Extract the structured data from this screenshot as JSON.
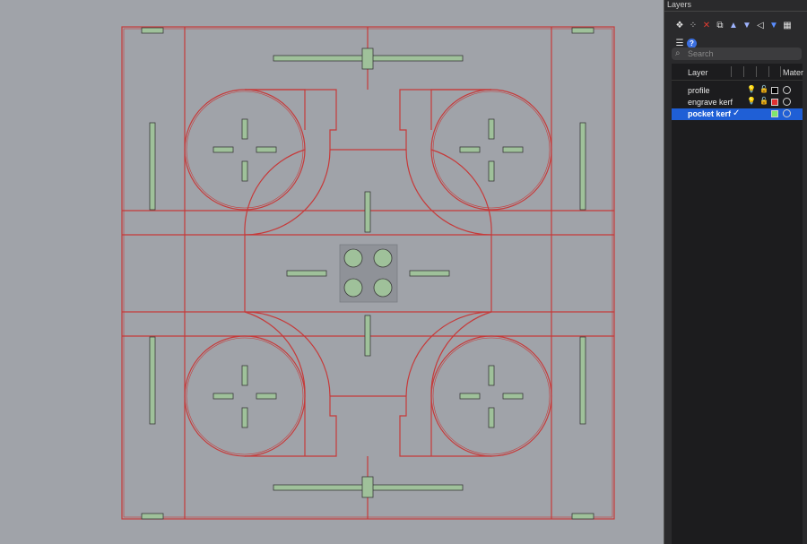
{
  "panel": {
    "title": "Layers",
    "toolbar": [
      {
        "name": "new-layer-icon",
        "glyph": "❖",
        "color": "#e0e0e0"
      },
      {
        "name": "new-sublayer-icon",
        "glyph": "⁘",
        "color": "#e0e0e0"
      },
      {
        "name": "delete-icon",
        "glyph": "✕",
        "color": "#e03c31"
      },
      {
        "name": "duplicate-icon",
        "glyph": "⧉",
        "color": "#e0e0e0"
      },
      {
        "name": "move-up-icon",
        "glyph": "▲",
        "color": "#9fb4ff"
      },
      {
        "name": "move-down-icon",
        "glyph": "▼",
        "color": "#9fb4ff"
      },
      {
        "name": "move-parent-icon",
        "glyph": "◁",
        "color": "#e0e0e0"
      },
      {
        "name": "filter-icon",
        "glyph": "▼",
        "color": "#5a8dff"
      },
      {
        "name": "grid-icon",
        "glyph": "▦",
        "color": "#e0e0e0"
      },
      {
        "name": "menu-icon",
        "glyph": "☰",
        "color": "#e0e0e0"
      },
      {
        "name": "help-icon",
        "glyph": "?",
        "color": "#ffffff"
      }
    ],
    "search_placeholder": "Search",
    "columns": {
      "layer": "Layer",
      "material": "Mater"
    },
    "layers": [
      {
        "name": "profile",
        "color": "#000000",
        "selected": false,
        "current": false
      },
      {
        "name": "engrave kerf",
        "color": "#e03030",
        "selected": false,
        "current": false
      },
      {
        "name": "pocket kerf",
        "color": "#7ee66e",
        "selected": true,
        "current": true
      }
    ]
  }
}
